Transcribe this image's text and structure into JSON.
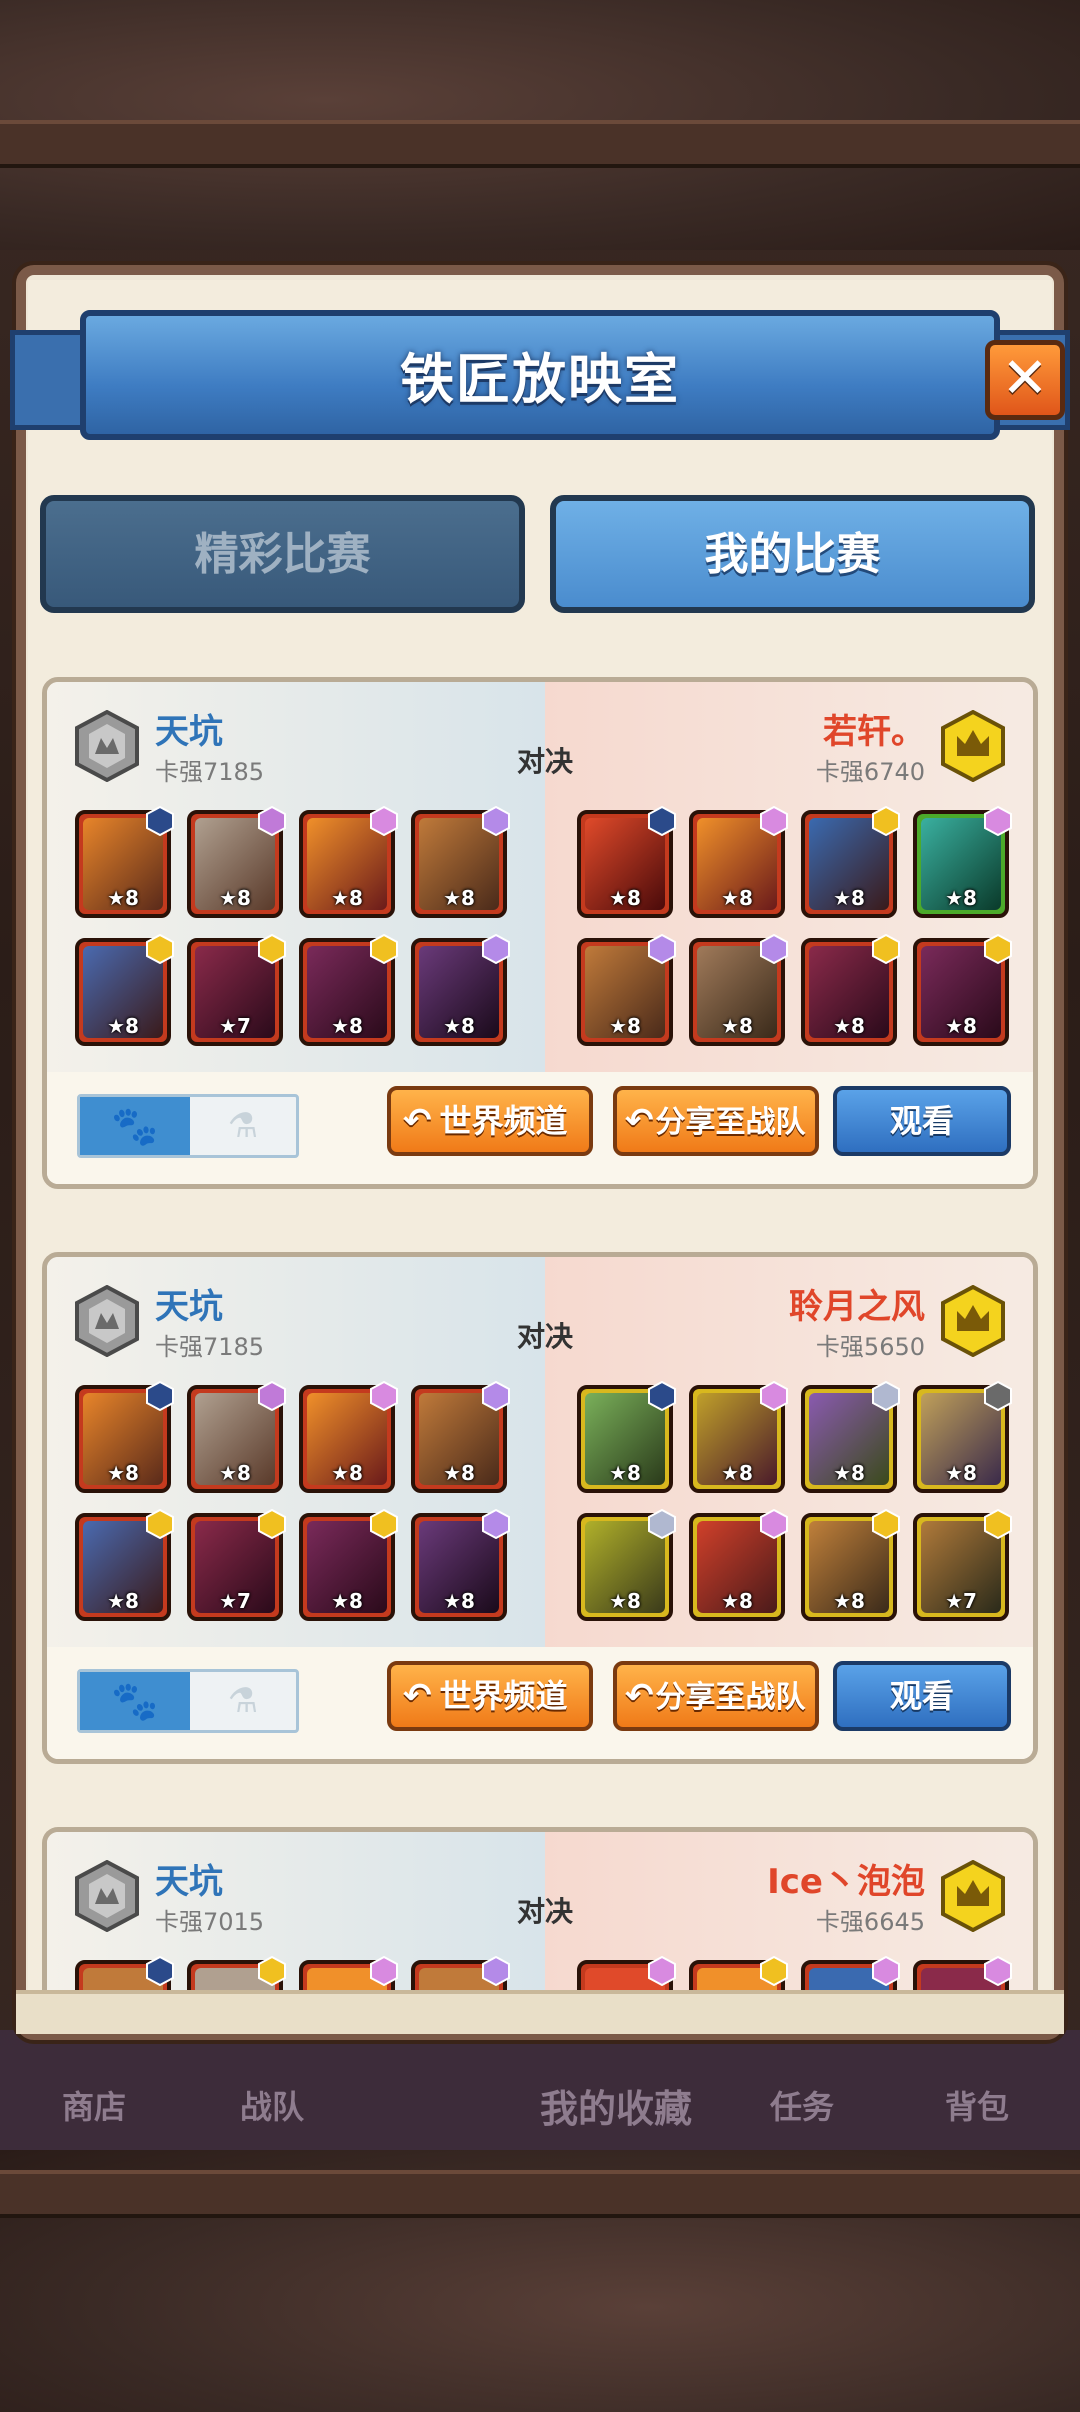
{
  "header": {
    "title": "铁匠放映室",
    "close_icon": "✕"
  },
  "tabs": [
    {
      "label": "精彩比赛",
      "active": false
    },
    {
      "label": "我的比赛",
      "active": true
    }
  ],
  "vs_label": "对决",
  "matches": [
    {
      "left": {
        "name": "天坑",
        "score": "卡强7185",
        "rank": "silver"
      },
      "right": {
        "name": "若轩。",
        "score": "卡强6740",
        "rank": "gold"
      },
      "left_stars": [
        "★8",
        "★8",
        "★8",
        "★8",
        "★8",
        "★7",
        "★8",
        "★8"
      ],
      "right_stars": [
        "★8",
        "★8",
        "★8",
        "★8",
        "★8",
        "★8",
        "★8",
        "★8"
      ],
      "buttons": {
        "world": "世界频道",
        "share": "分享至战队",
        "watch": "观看"
      }
    },
    {
      "left": {
        "name": "天坑",
        "score": "卡强7185",
        "rank": "silver"
      },
      "right": {
        "name": "聆月之风",
        "score": "卡强5650",
        "rank": "gold"
      },
      "left_stars": [
        "★8",
        "★8",
        "★8",
        "★8",
        "★8",
        "★7",
        "★8",
        "★8"
      ],
      "right_stars": [
        "★8",
        "★8",
        "★8",
        "★8",
        "★8",
        "★8",
        "★8",
        "★7"
      ],
      "buttons": {
        "world": "世界频道",
        "share": "分享至战队",
        "watch": "观看"
      }
    },
    {
      "left": {
        "name": "天坑",
        "score": "卡强7015",
        "rank": "silver"
      },
      "right": {
        "name": "Ice丶泡泡",
        "score": "卡强6645",
        "rank": "gold"
      }
    }
  ],
  "toggle": {
    "on_icon": "paw-icon",
    "off_icon": "potion-icon"
  },
  "bottom_nav": [
    "商店",
    "战队",
    "我的收藏",
    "任务",
    "背包"
  ],
  "colors": {
    "left_name": "#2f74b8",
    "right_name": "#e0462a",
    "accent_orange": "#f07a18",
    "accent_blue": "#2f6fc0"
  }
}
